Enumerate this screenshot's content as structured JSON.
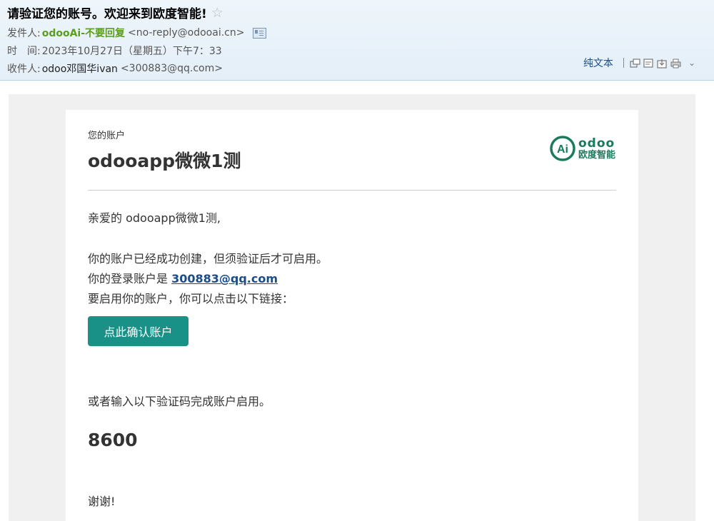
{
  "header": {
    "subject": "请验证您的账号。欢迎来到欧度智能!",
    "from_label": "发件人:",
    "from_name": "odooAi-不要回复",
    "from_email": "<no-reply@odooai.cn>",
    "time_label": "时　间:",
    "time_value": "2023年10月27日（星期五）下午7：33",
    "to_label": "收件人:",
    "to_name": "odoo邓国华ivan",
    "to_email": "<300883@qq.com>",
    "plain_text_label": "纯文本"
  },
  "email": {
    "account_label": "您的账户",
    "account_name": "odooapp微微1测",
    "logo_en": "odoo",
    "logo_cn": "欧度智能",
    "logo_mark": "Ai",
    "greeting": "亲爱的 odooapp微微1测,",
    "line1": "你的账户已经成功创建，但须验证后才可启用。",
    "login_prefix": "你的登录账户是 ",
    "login_email": "300883@qq.com",
    "line3": "要启用你的账户，你可以点击以下链接：",
    "confirm_button": "点此确认账户",
    "alt_text": "或者输入以下验证码完成账户启用。",
    "code": "8600",
    "thanks": "谢谢!"
  },
  "colors": {
    "brand_green": "#1a7a5c",
    "button_teal": "#1a9187",
    "sender_green": "#5a9e1a",
    "link_blue": "#1a4d8a"
  }
}
